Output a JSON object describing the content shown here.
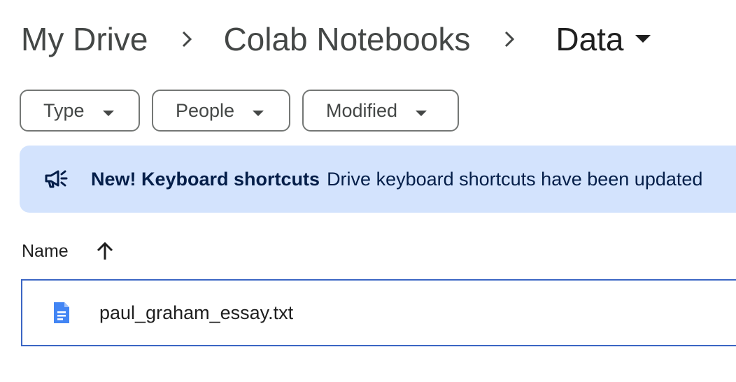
{
  "breadcrumb": {
    "items": [
      {
        "label": "My Drive",
        "icon": "chevron-right-icon"
      },
      {
        "label": "Colab Notebooks",
        "icon": "chevron-right-icon"
      },
      {
        "label": "Data",
        "icon": "caret-down-icon"
      }
    ]
  },
  "filters": {
    "chips": [
      {
        "label": "Type",
        "icon": "caret-down-icon"
      },
      {
        "label": "People",
        "icon": "caret-down-icon"
      },
      {
        "label": "Modified",
        "icon": "caret-down-icon"
      }
    ]
  },
  "banner": {
    "icon": "megaphone-icon",
    "title": "New! Keyboard shortcuts",
    "text": "Drive keyboard shortcuts have been updated",
    "background": "#d3e3fd"
  },
  "list": {
    "header": {
      "name_label": "Name",
      "sort_icon": "arrow-up-icon"
    },
    "rows": [
      {
        "name": "paul_graham_essay.txt",
        "icon": "google-docs-icon",
        "icon_color": "#4285f4"
      }
    ],
    "selected_border_color": "#3b66c4"
  }
}
